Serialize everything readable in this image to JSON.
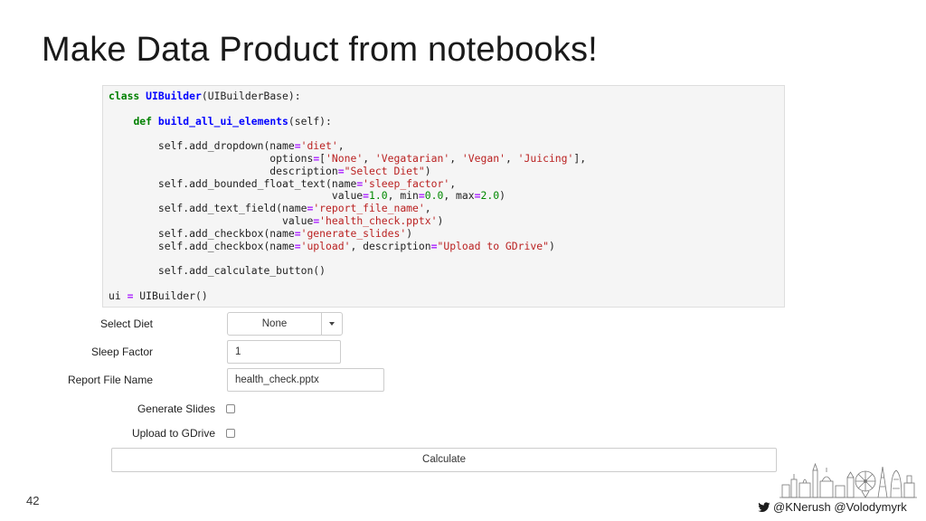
{
  "slide": {
    "title": "Make Data Product from notebooks!",
    "page_number": "42",
    "footer_handles": "@KNerush @Volodymyrk",
    "icons": [
      "twitter-bird-icon",
      "london-skyline-illustration"
    ]
  },
  "code": {
    "lines": [
      [
        {
          "t": "class",
          "c": "kw"
        },
        {
          "t": " "
        },
        {
          "t": "UIBuilder",
          "c": "nm"
        },
        {
          "t": "(UIBuilderBase):"
        }
      ],
      [],
      [
        {
          "t": "    "
        },
        {
          "t": "def",
          "c": "kw"
        },
        {
          "t": " "
        },
        {
          "t": "build_all_ui_elements",
          "c": "fn"
        },
        {
          "t": "(self):"
        }
      ],
      [],
      [
        {
          "t": "        self.add_dropdown(name"
        },
        {
          "t": "=",
          "c": "op"
        },
        {
          "t": "'diet'",
          "c": "st"
        },
        {
          "t": ","
        }
      ],
      [
        {
          "t": "                          options"
        },
        {
          "t": "=",
          "c": "op"
        },
        {
          "t": "["
        },
        {
          "t": "'None'",
          "c": "st"
        },
        {
          "t": ", "
        },
        {
          "t": "'Vegatarian'",
          "c": "st"
        },
        {
          "t": ", "
        },
        {
          "t": "'Vegan'",
          "c": "st"
        },
        {
          "t": ", "
        },
        {
          "t": "'Juicing'",
          "c": "st"
        },
        {
          "t": "],"
        }
      ],
      [
        {
          "t": "                          description"
        },
        {
          "t": "=",
          "c": "op"
        },
        {
          "t": "\"Select Diet\"",
          "c": "st"
        },
        {
          "t": ")"
        }
      ],
      [
        {
          "t": "        self.add_bounded_float_text(name"
        },
        {
          "t": "=",
          "c": "op"
        },
        {
          "t": "'sleep_factor'",
          "c": "st"
        },
        {
          "t": ","
        }
      ],
      [
        {
          "t": "                                    value"
        },
        {
          "t": "=",
          "c": "op"
        },
        {
          "t": "1.0",
          "c": "num"
        },
        {
          "t": ", min"
        },
        {
          "t": "=",
          "c": "op"
        },
        {
          "t": "0.0",
          "c": "num"
        },
        {
          "t": ", max"
        },
        {
          "t": "=",
          "c": "op"
        },
        {
          "t": "2.0",
          "c": "num"
        },
        {
          "t": ")"
        }
      ],
      [
        {
          "t": "        self.add_text_field(name"
        },
        {
          "t": "=",
          "c": "op"
        },
        {
          "t": "'report_file_name'",
          "c": "st"
        },
        {
          "t": ","
        }
      ],
      [
        {
          "t": "                            value"
        },
        {
          "t": "=",
          "c": "op"
        },
        {
          "t": "'health_check.pptx'",
          "c": "st"
        },
        {
          "t": ")"
        }
      ],
      [
        {
          "t": "        self.add_checkbox(name"
        },
        {
          "t": "=",
          "c": "op"
        },
        {
          "t": "'generate_slides'",
          "c": "st"
        },
        {
          "t": ")"
        }
      ],
      [
        {
          "t": "        self.add_checkbox(name"
        },
        {
          "t": "=",
          "c": "op"
        },
        {
          "t": "'upload'",
          "c": "st"
        },
        {
          "t": ", description"
        },
        {
          "t": "=",
          "c": "op"
        },
        {
          "t": "\"Upload to GDrive\"",
          "c": "st"
        },
        {
          "t": ")"
        }
      ],
      [],
      [
        {
          "t": "        self.add_calculate_button()"
        }
      ],
      [],
      [
        {
          "t": "ui "
        },
        {
          "t": "=",
          "c": "op"
        },
        {
          "t": " UIBuilder()"
        }
      ]
    ]
  },
  "widgets": {
    "diet": {
      "label": "Select Diet",
      "value": "None"
    },
    "sleep_factor": {
      "label": "Sleep Factor",
      "value": "1"
    },
    "report_file_name": {
      "label": "Report File Name",
      "value": "health_check.pptx"
    },
    "generate_slides": {
      "label": "Generate Slides",
      "checked": false
    },
    "upload": {
      "label": "Upload to GDrive",
      "checked": false
    },
    "calculate_label": "Calculate"
  },
  "colors": {
    "keyword": "#008000",
    "name": "#0000ff",
    "string": "#ba2121",
    "number": "#008800",
    "operator": "#aa22ff",
    "twitter": "#1da1f2"
  }
}
